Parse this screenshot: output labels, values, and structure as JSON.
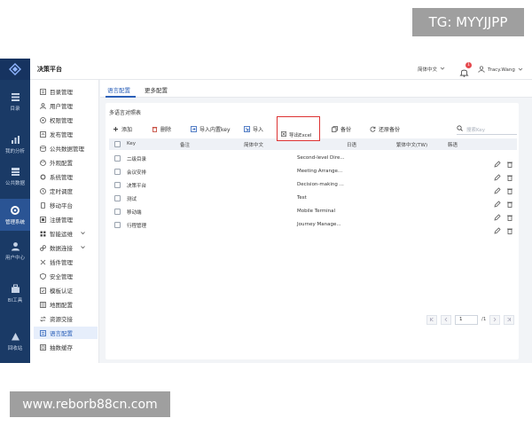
{
  "watermarks": {
    "top": "TG: MYYJJPP",
    "bottom": "www.reborb88cn.com"
  },
  "app": {
    "title": "决策平台"
  },
  "header": {
    "language": "简体中文",
    "notification_count": "1",
    "user_name": "Tracy.Wang"
  },
  "rail": [
    {
      "label": "目录",
      "icon": "catalog-icon"
    },
    {
      "label": "我的分析",
      "icon": "chart-icon"
    },
    {
      "label": "公共数据",
      "icon": "database-icon"
    },
    {
      "label": "管理系统",
      "icon": "gear-icon",
      "active": true
    },
    {
      "label": "用户中心",
      "icon": "user-icon"
    },
    {
      "label": "BI工具",
      "icon": "toolbox-icon"
    },
    {
      "label": "回收站",
      "icon": "recycle-icon"
    }
  ],
  "sidebar": [
    {
      "label": "目录管理",
      "icon": "folder-icon"
    },
    {
      "label": "用户管理",
      "icon": "user-icon"
    },
    {
      "label": "权限管理",
      "icon": "shield-icon"
    },
    {
      "label": "发布管理",
      "icon": "publish-icon"
    },
    {
      "label": "公共数据管理",
      "icon": "database-icon"
    },
    {
      "label": "外观配置",
      "icon": "palette-icon"
    },
    {
      "label": "系统管理",
      "icon": "gear-icon"
    },
    {
      "label": "定时调度",
      "icon": "clock-icon"
    },
    {
      "label": "移动平台",
      "icon": "mobile-icon"
    },
    {
      "label": "注册管理",
      "icon": "register-icon"
    },
    {
      "label": "智能运维",
      "icon": "ops-icon",
      "expandable": true
    },
    {
      "label": "数据连接",
      "icon": "link-icon",
      "expandable": true
    },
    {
      "label": "插件管理",
      "icon": "plugin-icon"
    },
    {
      "label": "安全管理",
      "icon": "shield-check-icon"
    },
    {
      "label": "模板认证",
      "icon": "template-icon"
    },
    {
      "label": "地图配置",
      "icon": "map-icon"
    },
    {
      "label": "资源交接",
      "icon": "exchange-icon"
    },
    {
      "label": "语言配置",
      "icon": "language-icon",
      "active": true
    },
    {
      "label": "抽数缓存",
      "icon": "cache-icon"
    }
  ],
  "tabs": [
    {
      "label": "语言配置",
      "active": true
    },
    {
      "label": "更多配置",
      "active": false
    }
  ],
  "panel": {
    "title": "多语言对照表"
  },
  "toolbar": {
    "add": "添加",
    "delete": "删除",
    "import_key": "导入内置key",
    "import": "导入",
    "export": "导出",
    "backup": "备份",
    "restore": "还原备份",
    "search_placeholder": "搜索Key",
    "export_menu_item": "导出Excel"
  },
  "table": {
    "columns": [
      "Key",
      "备注",
      "简体中文",
      "",
      "日语",
      "繁体中文(TW)",
      "韩语"
    ],
    "rows": [
      {
        "key": "二级目录",
        "english": "Second-level Dire..."
      },
      {
        "key": "会议安排",
        "english": "Meeting Arrange..."
      },
      {
        "key": "决策平台",
        "english": "Decision-making ..."
      },
      {
        "key": "测试",
        "english": "Test"
      },
      {
        "key": "移动端",
        "english": "Mobile Terminal"
      },
      {
        "key": "行程管理",
        "english": "Journey Manage..."
      }
    ]
  },
  "pagination": {
    "current": "1",
    "total": "/1"
  }
}
